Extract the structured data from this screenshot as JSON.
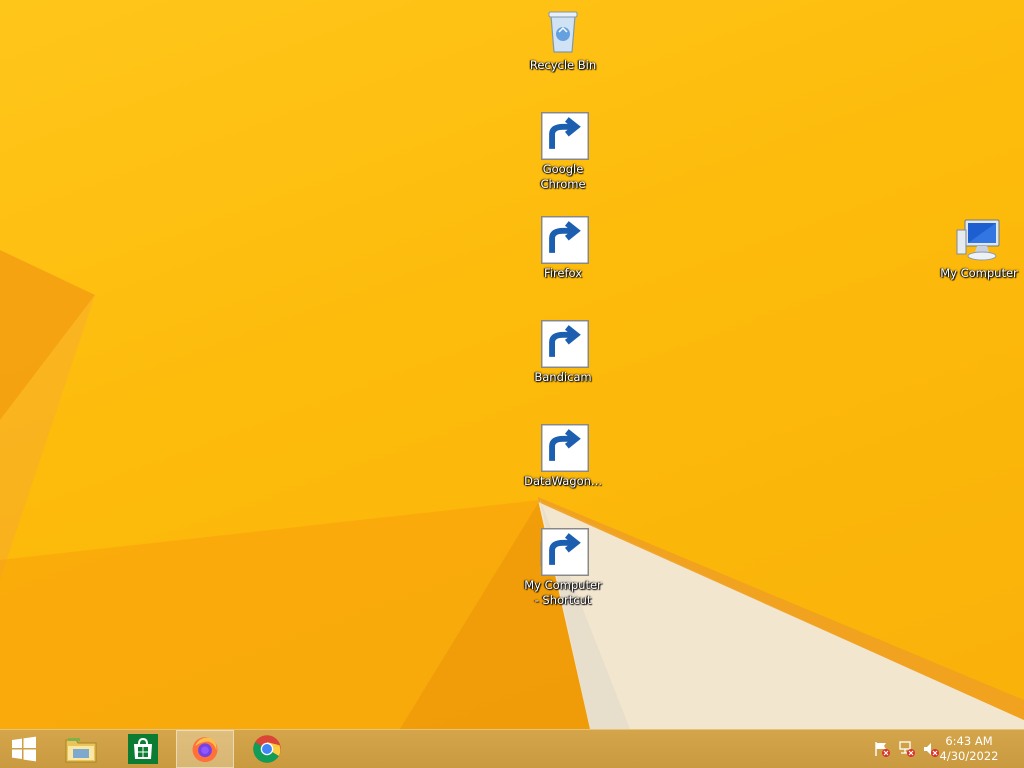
{
  "desktop": {
    "icons": [
      {
        "label": "Recycle Bin",
        "icon": "recycle-bin-icon",
        "shortcut": false
      },
      {
        "label": "Google\nChrome",
        "icon": "chrome-icon",
        "shortcut": true
      },
      {
        "label": "Firefox",
        "icon": "firefox-icon",
        "shortcut": true
      },
      {
        "label": "Bandicam",
        "icon": "bandicam-icon",
        "shortcut": true
      },
      {
        "label": "DataWagon...",
        "icon": "datawagon-icon",
        "shortcut": true
      },
      {
        "label": "My Computer\n- Shortcut",
        "icon": "computer-icon",
        "shortcut": true
      },
      {
        "label": "My Computer",
        "icon": "computer-icon",
        "shortcut": false
      }
    ]
  },
  "taskbar": {
    "buttons": [
      {
        "name": "start",
        "icon": "windows-logo-icon"
      },
      {
        "name": "file-explorer",
        "icon": "folder-icon"
      },
      {
        "name": "store",
        "icon": "store-icon"
      },
      {
        "name": "firefox",
        "icon": "firefox-icon",
        "active": true
      },
      {
        "name": "chrome",
        "icon": "chrome-icon"
      }
    ],
    "tray": {
      "icons": [
        "action-center-flag-icon",
        "network-icon",
        "volume-muted-icon"
      ],
      "time": "6:43 AM",
      "date": "4/30/2022"
    }
  },
  "colors": {
    "wallpaper": "#fdbb0b",
    "taskbar": "#cf9f45"
  }
}
